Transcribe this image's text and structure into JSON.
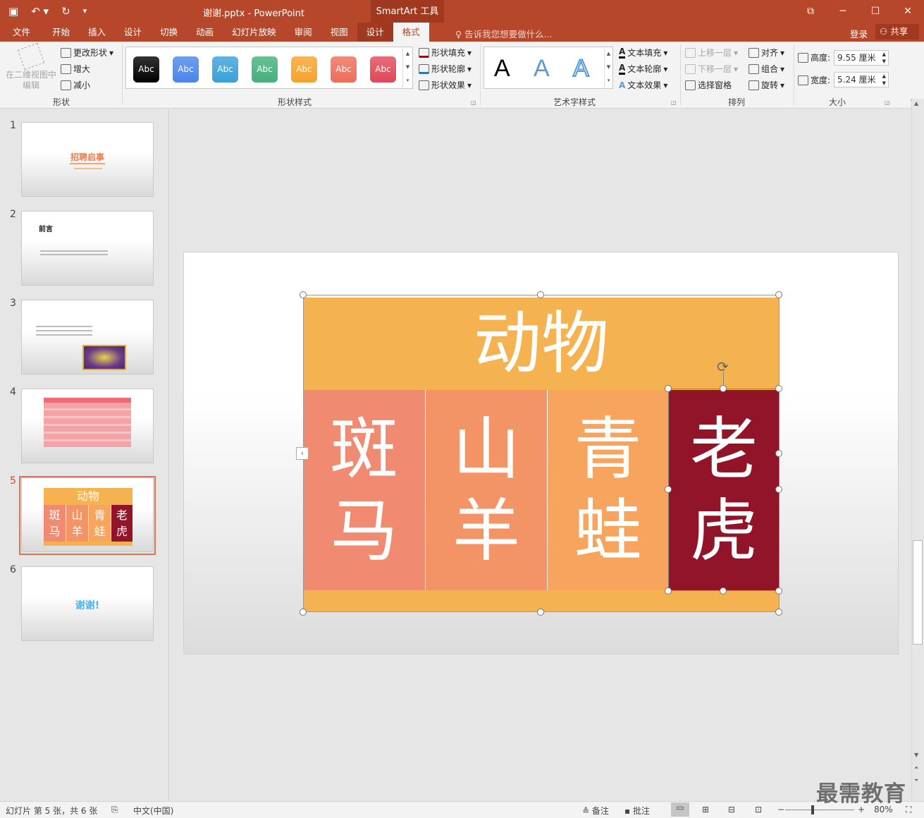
{
  "title_bar": {
    "doc_title": "谢谢.pptx - PowerPoint",
    "contextual_tool": "SmartArt 工具",
    "icons": [
      "save-icon",
      "undo-icon",
      "redo-icon",
      "customize-qat-icon"
    ]
  },
  "tabs": [
    "文件",
    "开始",
    "插入",
    "设计",
    "切换",
    "动画",
    "幻灯片放映",
    "审阅",
    "视图"
  ],
  "smart_tabs": [
    "设计",
    "格式"
  ],
  "active_tab": "格式",
  "tell_me": "告诉我您想要做什么...",
  "login": "登录",
  "share": "共享",
  "ribbon": {
    "shapes_group": {
      "edit_2d_line1": "在二维视图中",
      "edit_2d_line2": "编辑",
      "change_shape": "更改形状",
      "enlarge": "增大",
      "shrink": "减小",
      "label": "形状"
    },
    "shape_styles": {
      "swatch_text": "Abc",
      "swatches": [
        "#000000",
        "#4a86e8",
        "#3aa0d8",
        "#45b07b",
        "#f6a22b",
        "#ec6e59",
        "#e04858"
      ],
      "fill": "形状填充",
      "outline": "形状轮廓",
      "effects": "形状效果",
      "label": "形状样式"
    },
    "wordart": {
      "letter": "A",
      "text_fill": "文本填充",
      "text_outline": "文本轮廓",
      "text_effects": "文本效果",
      "label": "艺术字样式"
    },
    "arrange": {
      "bring_forward": "上移一层",
      "send_backward": "下移一层",
      "selection_pane": "选择窗格",
      "align": "对齐",
      "group": "组合",
      "rotate": "旋转",
      "label": "排列"
    },
    "size": {
      "height_label": "高度:",
      "height_value": "9.55 厘米",
      "width_label": "宽度:",
      "width_value": "5.24 厘米",
      "label": "大小"
    }
  },
  "thumbnails": {
    "numbers": [
      "1",
      "2",
      "3",
      "4",
      "5",
      "6"
    ],
    "current": 5,
    "s1_title": "招聘启事",
    "s2_title": "前言",
    "s5_top": "动物",
    "s6_text": "谢谢!"
  },
  "smartart": {
    "top": "动物",
    "cells": [
      {
        "l1": "斑",
        "l2": "马",
        "color": "#f08a70"
      },
      {
        "l1": "山",
        "l2": "羊",
        "color": "#f39467"
      },
      {
        "l1": "青",
        "l2": "蛙",
        "color": "#f6a45e"
      },
      {
        "l1": "老",
        "l2": "虎",
        "color": "#911428"
      }
    ]
  },
  "status": {
    "slide_info": "幻灯片 第 5 张，共 6 张",
    "language": "中文(中国)",
    "notes": "备注",
    "comments": "批注",
    "zoom": "80%"
  },
  "watermark": "最需教育"
}
